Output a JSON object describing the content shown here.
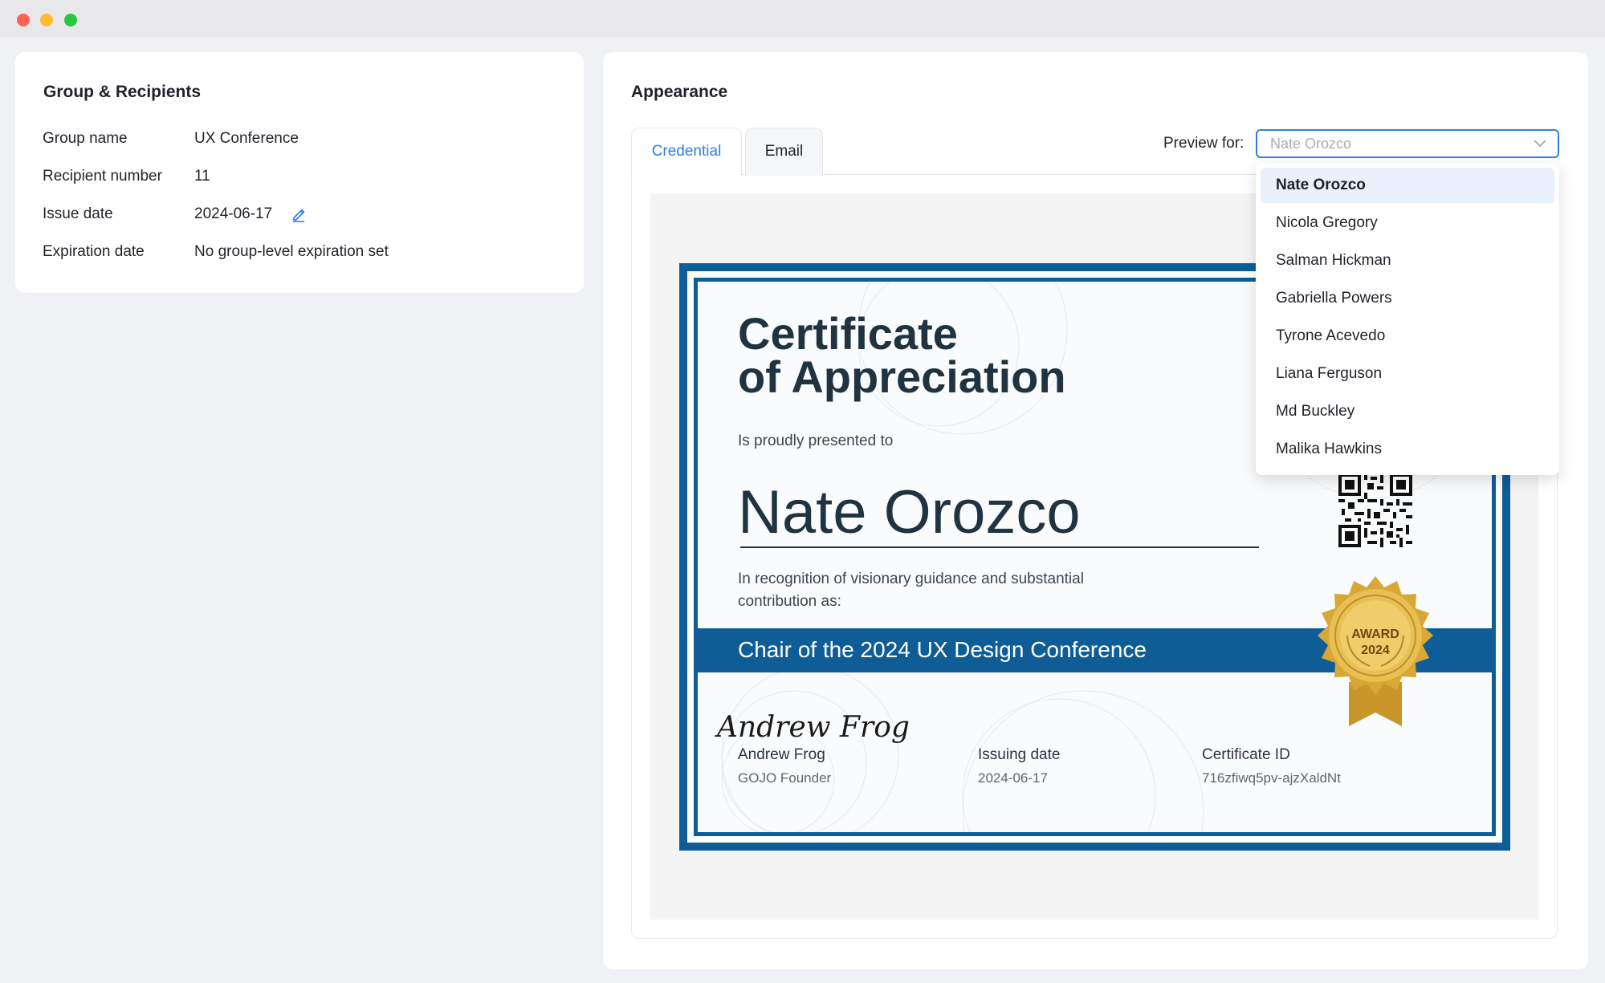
{
  "window": {
    "controls": [
      {
        "name": "close",
        "color": "#fe5f57"
      },
      {
        "name": "minimize",
        "color": "#febc2e"
      },
      {
        "name": "zoom",
        "color": "#28c840"
      }
    ]
  },
  "group_card": {
    "title": "Group & Recipients",
    "rows": [
      {
        "label": "Group name",
        "value": "UX Conference"
      },
      {
        "label": "Recipient number",
        "value": "11"
      },
      {
        "label": "Issue date",
        "value": "2024-06-17",
        "icon": "pencil-icon"
      },
      {
        "label": "Expiration date",
        "value": "No group-level expiration set"
      }
    ]
  },
  "appearance": {
    "title": "Appearance",
    "tabs": [
      {
        "label": "Credential",
        "active": true
      },
      {
        "label": "Email",
        "active": false
      }
    ],
    "preview_label": "Preview for:",
    "preview_select": {
      "value": "Nate Orozco",
      "icon": "chevron-down-icon"
    },
    "preview_options": [
      "Nate Orozco",
      "Nicola Gregory",
      "Salman Hickman",
      "Gabriella Powers",
      "Tyrone Acevedo",
      "Liana Ferguson",
      "Md Buckley",
      "Malika Hawkins"
    ],
    "selected_option": "Nate Orozco"
  },
  "certificate": {
    "title_line1": "Certificate",
    "title_line2": "of Appreciation",
    "presented_to": "Is proudly presented to",
    "recipient_name": "Nate Orozco",
    "recognition_line1": "In recognition of visionary guidance and substantial",
    "recognition_line2": "contribution as:",
    "role": "Chair of the 2024 UX Design Conference",
    "signature": "Andrew Frog",
    "signer_name": "Andrew Frog",
    "signer_title": "GOJO Founder",
    "issuing_date_label": "Issuing date",
    "issuing_date": "2024-06-17",
    "certificate_id_label": "Certificate ID",
    "certificate_id": "716zfiwq5pv-ajzXaldNt",
    "seal_line1": "AWARD",
    "seal_line2": "2024",
    "colors": {
      "primary": "#0e5d97",
      "title": "#1f3340",
      "gold": "#d9a733"
    }
  },
  "colors": {
    "accent": "#2f7fe0",
    "background": "#f0f1f4",
    "selected_row": "#e9f1fd"
  }
}
